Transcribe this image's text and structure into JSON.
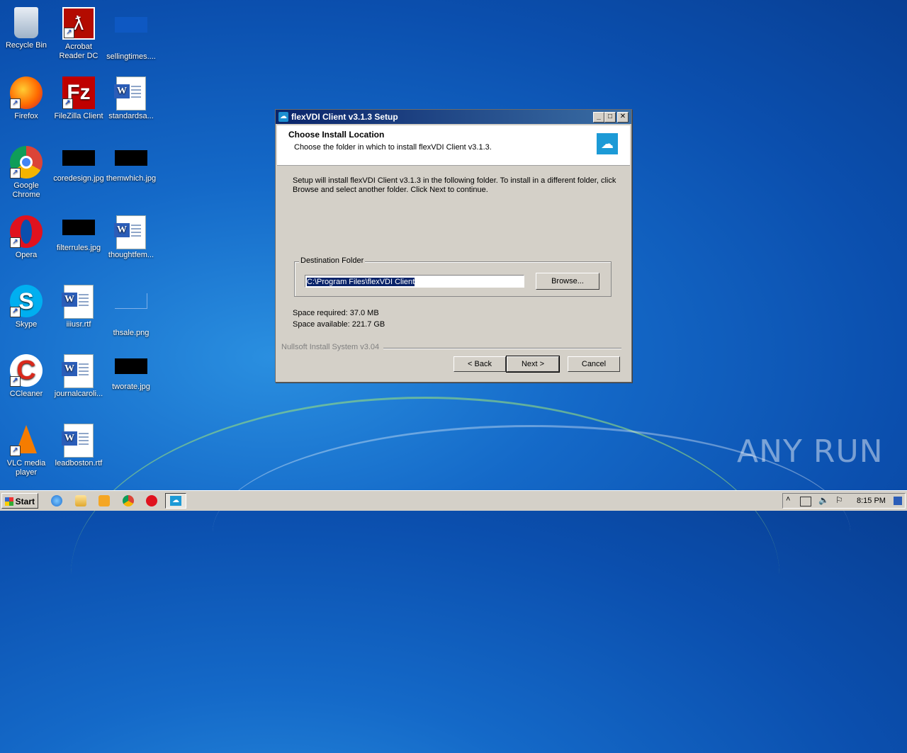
{
  "desktop": {
    "icons": [
      {
        "label": "Recycle Bin"
      },
      {
        "label": "Acrobat Reader DC"
      },
      {
        "label": "sellingtimes...."
      },
      {
        "label": "Firefox"
      },
      {
        "label": "FileZilla Client"
      },
      {
        "label": "standardsa..."
      },
      {
        "label": "Google Chrome"
      },
      {
        "label": "coredesign.jpg"
      },
      {
        "label": "themwhich.jpg"
      },
      {
        "label": "Opera"
      },
      {
        "label": "filterrules.jpg"
      },
      {
        "label": "thoughtfem..."
      },
      {
        "label": "Skype"
      },
      {
        "label": "iiiusr.rtf"
      },
      {
        "label": "thsale.png"
      },
      {
        "label": "CCleaner"
      },
      {
        "label": "journalcaroli..."
      },
      {
        "label": "tworate.jpg"
      },
      {
        "label": "VLC media player"
      },
      {
        "label": "leadboston.rtf"
      }
    ],
    "watermark": "ANY RUN"
  },
  "dialog": {
    "title": "flexVDI Client v3.1.3 Setup",
    "header_title": "Choose Install Location",
    "header_subtitle": "Choose the folder in which to install flexVDI Client v3.1.3.",
    "body_text": "Setup will install flexVDI Client v3.1.3 in the following folder. To install in a different folder, click Browse and select another folder. Click Next to continue.",
    "destination_label": "Destination Folder",
    "destination_path": "C:\\Program Files\\flexVDI Client",
    "browse_label": "Browse...",
    "space_required": "Space required: 37.0 MB",
    "space_available": "Space available: 221.7 GB",
    "branding": "Nullsoft Install System v3.04",
    "back_label": "< Back",
    "next_label": "Next >",
    "cancel_label": "Cancel"
  },
  "taskbar": {
    "start_label": "Start",
    "clock": "8:15 PM"
  }
}
